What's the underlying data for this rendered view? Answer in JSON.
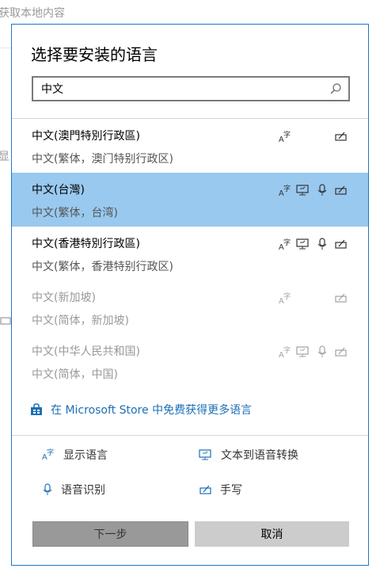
{
  "background": {
    "top_text": "获取本地内容",
    "mid_text": "显"
  },
  "dialog": {
    "title": "选择要安装的语言",
    "search": {
      "value": "中文",
      "placeholder": ""
    },
    "languages": [
      {
        "name": "中文(澳門特別行政區)",
        "sub": "中文(繁体，澳门特别行政区)",
        "features": [
          "display",
          "handwriting"
        ],
        "state": "normal"
      },
      {
        "name": "中文(台灣)",
        "sub": "中文(繁体，台湾)",
        "features": [
          "display",
          "tts",
          "speech",
          "handwriting"
        ],
        "state": "selected"
      },
      {
        "name": "中文(香港特別行政區)",
        "sub": "中文(繁体，香港特别行政区)",
        "features": [
          "display",
          "tts",
          "speech",
          "handwriting"
        ],
        "state": "normal"
      },
      {
        "name": "中文(新加坡)",
        "sub": "中文(简体，新加坡)",
        "features": [
          "display",
          "handwriting"
        ],
        "state": "dim"
      },
      {
        "name": "中文(中华人民共和国)",
        "sub": "中文(简体，中国)",
        "features": [
          "display",
          "tts",
          "speech",
          "handwriting"
        ],
        "state": "dim"
      }
    ],
    "store_link": "在 Microsoft Store 中免费获得更多语言",
    "legend": {
      "display": "显示语言",
      "tts": "文本到语音转换",
      "speech": "语音识别",
      "handwriting": "手写"
    },
    "buttons": {
      "next": "下一步",
      "cancel": "取消"
    }
  },
  "colors": {
    "accent": "#1b78c8",
    "selected": "#99c9ef",
    "link": "#1b6fb5"
  }
}
